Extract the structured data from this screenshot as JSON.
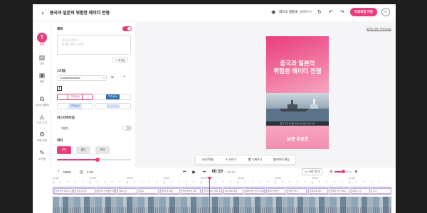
{
  "header": {
    "title": "중국과 일본의 위험한 레이더 전쟁",
    "mode_label": "레디오 템플릿",
    "mode_action": "플레이기",
    "export_label": "무료체험 저장",
    "avatar_glyph": "☺"
  },
  "rail": {
    "items": [
      {
        "label": "제목",
        "glyph": "T",
        "active": true
      },
      {
        "label": "자막",
        "glyph": "▤"
      },
      {
        "label": "배경",
        "glyph": "▣"
      },
      {
        "label": "스마트 템플릿",
        "glyph": "⧉"
      },
      {
        "label": "요소 추가",
        "glyph": "◬"
      },
      {
        "label": "화면 설정",
        "glyph": "⚙"
      },
      {
        "label": "AI 편집",
        "glyph": "✎"
      }
    ]
  },
  "panel": {
    "title_section": "제목",
    "placeholder": "중국과 일본의\n위험한 레이더 전쟁",
    "reset_label": "재생성",
    "style_section": "스타일",
    "font_name": "GmarketSansBold",
    "font_size": "86",
    "color_chip_1": "자막글씨",
    "color_chip_2": "자막글씨",
    "color_chip_3": "자막글씨",
    "custom_section": "커스터마이징",
    "shadow_label": "그림자",
    "position_section": "위치",
    "positions": [
      "상단",
      "중단",
      "하단"
    ],
    "position_active_index": 0,
    "offset_fraction": 0.55
  },
  "canvas": {
    "guide_link": "제안자 사용 가이드(2분)",
    "headline": "중국과 일본의\n위험한 레이더 전쟁",
    "caption": "중국 군함 공격용 레이더로 일본 함정 추적",
    "subline": "30분 무료권"
  },
  "context_bar": {
    "selection": "1개 선택됨",
    "cut": "자르기",
    "delete": "삭제하기",
    "edit_layer": "레이어 편집"
  },
  "player": {
    "zoom": "100%",
    "speed": "1.0x",
    "current_time": "00:10",
    "total_time": "00:50",
    "add_clip_label": "구간 추가"
  },
  "timeline": {
    "ticks": [
      "00:00",
      "00:05",
      "00:10",
      "00:15",
      "00:20",
      "00:25",
      "00:30",
      "00:35",
      "00:40"
    ],
    "clips": [
      "일본 정부 레이더 조사",
      "이번 사건은",
      "이번이 도발했을 일본 해협",
      "상황 보고",
      "중국",
      "레이더로 비판",
      "일본 정부는 이번",
      "이 전투기는 국제 규칙",
      "중국 대응 공개",
      "이미 일본 전투기 공격용",
      "레이더 일본 군",
      "결국 전투기",
      "국제 문제 제기",
      "일본은 전투 레이더",
      "국제적 교훈",
      "근거"
    ]
  },
  "colors": {
    "accent": "#e83c7c",
    "clip_track": "#efe4f7"
  }
}
